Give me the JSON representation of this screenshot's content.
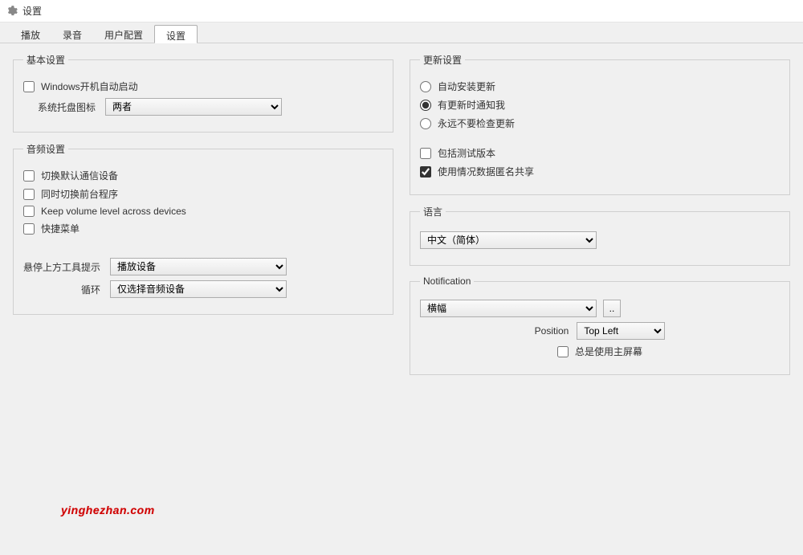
{
  "window": {
    "title": "设置"
  },
  "tabs": [
    {
      "label": "播放"
    },
    {
      "label": "录音"
    },
    {
      "label": "用户配置"
    },
    {
      "label": "设置",
      "active": true
    }
  ],
  "basic": {
    "legend": "基本设置",
    "autostart": {
      "label": "Windows开机自动启动",
      "checked": false
    },
    "tray_icon_label": "系统托盘图标",
    "tray_icon_value": "两者"
  },
  "audio": {
    "legend": "音频设置",
    "switch_default_comm": {
      "label": "切换默认通信设备",
      "checked": false
    },
    "switch_foreground": {
      "label": "同时切换前台程序",
      "checked": false
    },
    "keep_volume": {
      "label": "Keep volume level across devices",
      "checked": false
    },
    "quick_menu": {
      "label": "快捷菜单",
      "checked": false
    },
    "tooltip_label": "悬停上方工具提示",
    "tooltip_value": "播放设备",
    "cycle_label": "循环",
    "cycle_value": "仅选择音频设备"
  },
  "update": {
    "legend": "更新设置",
    "mode": {
      "auto": "自动安装更新",
      "notify": "有更新时通知我",
      "never": "永远不要检查更新",
      "selected": "notify"
    },
    "include_beta": {
      "label": "包括测试版本",
      "checked": false
    },
    "telemetry": {
      "label": "使用情况数据匿名共享",
      "checked": true
    }
  },
  "language": {
    "legend": "语言",
    "value": "中文（简体）"
  },
  "notification": {
    "legend": "Notification",
    "type_value": "横幅",
    "position_label": "Position",
    "position_value": "Top Left",
    "primary_screen": {
      "label": "总是使用主屏幕",
      "checked": false
    },
    "more_button": ".."
  },
  "watermark": "yinghezhan.com"
}
